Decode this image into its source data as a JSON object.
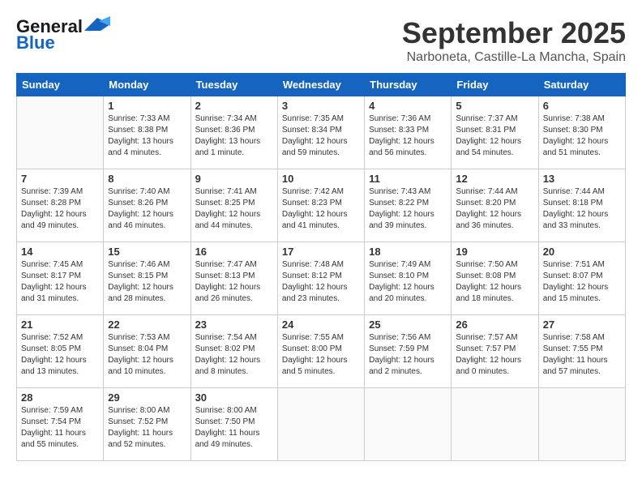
{
  "header": {
    "logo_line1": "General",
    "logo_line2": "Blue",
    "month": "September 2025",
    "location": "Narboneta, Castille-La Mancha, Spain"
  },
  "weekdays": [
    "Sunday",
    "Monday",
    "Tuesday",
    "Wednesday",
    "Thursday",
    "Friday",
    "Saturday"
  ],
  "weeks": [
    [
      {
        "day": "",
        "info": ""
      },
      {
        "day": "1",
        "info": "Sunrise: 7:33 AM\nSunset: 8:38 PM\nDaylight: 13 hours\nand 4 minutes."
      },
      {
        "day": "2",
        "info": "Sunrise: 7:34 AM\nSunset: 8:36 PM\nDaylight: 13 hours\nand 1 minute."
      },
      {
        "day": "3",
        "info": "Sunrise: 7:35 AM\nSunset: 8:34 PM\nDaylight: 12 hours\nand 59 minutes."
      },
      {
        "day": "4",
        "info": "Sunrise: 7:36 AM\nSunset: 8:33 PM\nDaylight: 12 hours\nand 56 minutes."
      },
      {
        "day": "5",
        "info": "Sunrise: 7:37 AM\nSunset: 8:31 PM\nDaylight: 12 hours\nand 54 minutes."
      },
      {
        "day": "6",
        "info": "Sunrise: 7:38 AM\nSunset: 8:30 PM\nDaylight: 12 hours\nand 51 minutes."
      }
    ],
    [
      {
        "day": "7",
        "info": "Sunrise: 7:39 AM\nSunset: 8:28 PM\nDaylight: 12 hours\nand 49 minutes."
      },
      {
        "day": "8",
        "info": "Sunrise: 7:40 AM\nSunset: 8:26 PM\nDaylight: 12 hours\nand 46 minutes."
      },
      {
        "day": "9",
        "info": "Sunrise: 7:41 AM\nSunset: 8:25 PM\nDaylight: 12 hours\nand 44 minutes."
      },
      {
        "day": "10",
        "info": "Sunrise: 7:42 AM\nSunset: 8:23 PM\nDaylight: 12 hours\nand 41 minutes."
      },
      {
        "day": "11",
        "info": "Sunrise: 7:43 AM\nSunset: 8:22 PM\nDaylight: 12 hours\nand 39 minutes."
      },
      {
        "day": "12",
        "info": "Sunrise: 7:44 AM\nSunset: 8:20 PM\nDaylight: 12 hours\nand 36 minutes."
      },
      {
        "day": "13",
        "info": "Sunrise: 7:44 AM\nSunset: 8:18 PM\nDaylight: 12 hours\nand 33 minutes."
      }
    ],
    [
      {
        "day": "14",
        "info": "Sunrise: 7:45 AM\nSunset: 8:17 PM\nDaylight: 12 hours\nand 31 minutes."
      },
      {
        "day": "15",
        "info": "Sunrise: 7:46 AM\nSunset: 8:15 PM\nDaylight: 12 hours\nand 28 minutes."
      },
      {
        "day": "16",
        "info": "Sunrise: 7:47 AM\nSunset: 8:13 PM\nDaylight: 12 hours\nand 26 minutes."
      },
      {
        "day": "17",
        "info": "Sunrise: 7:48 AM\nSunset: 8:12 PM\nDaylight: 12 hours\nand 23 minutes."
      },
      {
        "day": "18",
        "info": "Sunrise: 7:49 AM\nSunset: 8:10 PM\nDaylight: 12 hours\nand 20 minutes."
      },
      {
        "day": "19",
        "info": "Sunrise: 7:50 AM\nSunset: 8:08 PM\nDaylight: 12 hours\nand 18 minutes."
      },
      {
        "day": "20",
        "info": "Sunrise: 7:51 AM\nSunset: 8:07 PM\nDaylight: 12 hours\nand 15 minutes."
      }
    ],
    [
      {
        "day": "21",
        "info": "Sunrise: 7:52 AM\nSunset: 8:05 PM\nDaylight: 12 hours\nand 13 minutes."
      },
      {
        "day": "22",
        "info": "Sunrise: 7:53 AM\nSunset: 8:04 PM\nDaylight: 12 hours\nand 10 minutes."
      },
      {
        "day": "23",
        "info": "Sunrise: 7:54 AM\nSunset: 8:02 PM\nDaylight: 12 hours\nand 8 minutes."
      },
      {
        "day": "24",
        "info": "Sunrise: 7:55 AM\nSunset: 8:00 PM\nDaylight: 12 hours\nand 5 minutes."
      },
      {
        "day": "25",
        "info": "Sunrise: 7:56 AM\nSunset: 7:59 PM\nDaylight: 12 hours\nand 2 minutes."
      },
      {
        "day": "26",
        "info": "Sunrise: 7:57 AM\nSunset: 7:57 PM\nDaylight: 12 hours\nand 0 minutes."
      },
      {
        "day": "27",
        "info": "Sunrise: 7:58 AM\nSunset: 7:55 PM\nDaylight: 11 hours\nand 57 minutes."
      }
    ],
    [
      {
        "day": "28",
        "info": "Sunrise: 7:59 AM\nSunset: 7:54 PM\nDaylight: 11 hours\nand 55 minutes."
      },
      {
        "day": "29",
        "info": "Sunrise: 8:00 AM\nSunset: 7:52 PM\nDaylight: 11 hours\nand 52 minutes."
      },
      {
        "day": "30",
        "info": "Sunrise: 8:00 AM\nSunset: 7:50 PM\nDaylight: 11 hours\nand 49 minutes."
      },
      {
        "day": "",
        "info": ""
      },
      {
        "day": "",
        "info": ""
      },
      {
        "day": "",
        "info": ""
      },
      {
        "day": "",
        "info": ""
      }
    ]
  ]
}
